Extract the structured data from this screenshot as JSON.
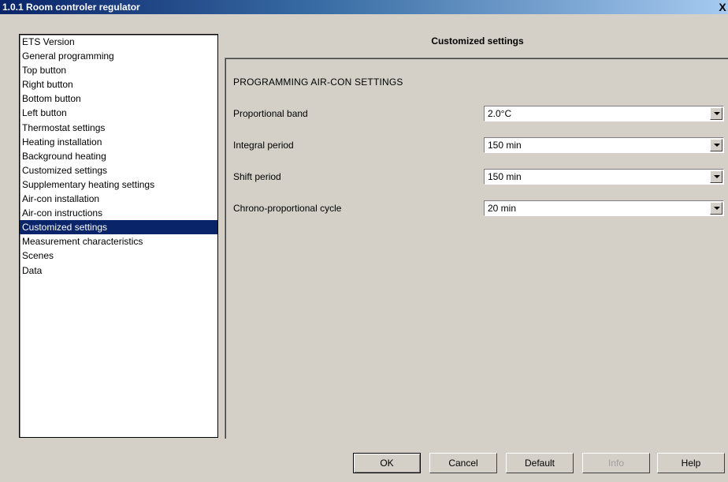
{
  "window": {
    "title": "1.0.1 Room controler regulator",
    "close_label": "X"
  },
  "nav": {
    "items": [
      "ETS Version",
      "General programming",
      "Top button",
      "Right button",
      "Bottom button",
      "Left button",
      "Thermostat settings",
      "Heating installation",
      "Background heating",
      "Customized settings",
      "Supplementary heating settings",
      "Air-con installation",
      "Air-con instructions",
      "Customized settings",
      "Measurement characteristics",
      "Scenes",
      "Data"
    ],
    "selected_index": 13
  },
  "panel": {
    "header": "Customized settings",
    "section_title": "PROGRAMMING AIR-CON SETTINGS",
    "rows": [
      {
        "label": "Proportional band",
        "value": "2.0°C"
      },
      {
        "label": "Integral period",
        "value": "150 min"
      },
      {
        "label": "Shift period",
        "value": "150 min"
      },
      {
        "label": "Chrono-proportional cycle",
        "value": "20 min"
      }
    ]
  },
  "buttons": {
    "ok": "OK",
    "cancel": "Cancel",
    "default": "Default",
    "info": "Info",
    "help": "Help"
  },
  "colors": {
    "selection": "#0a246a",
    "face": "#d4d0c8"
  }
}
